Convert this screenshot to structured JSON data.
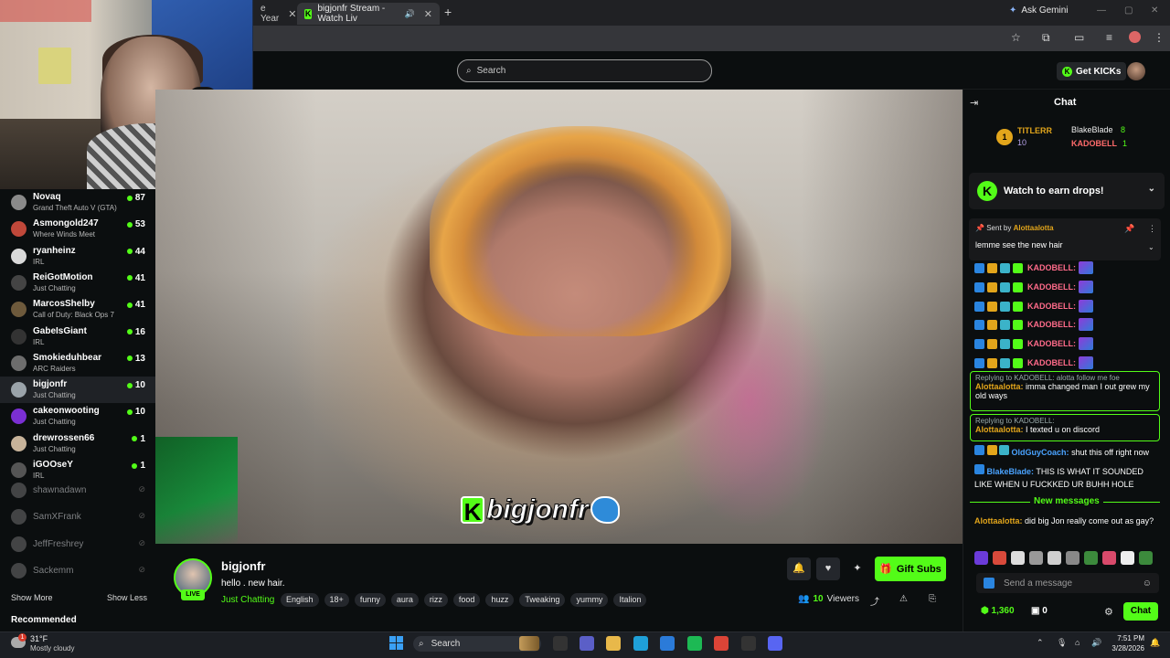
{
  "browser": {
    "tab1_title": "e Year",
    "tab2_title": "bigjonfr Stream - Watch Liv",
    "ask_gemini": "Ask Gemini"
  },
  "header": {
    "search_placeholder": "Search",
    "get_kicks": "Get KICKs"
  },
  "sidebar": {
    "channels": [
      {
        "name": "Novaq",
        "category": "Grand Theft Auto V (GTA)",
        "viewers": "87",
        "color": "#8a8a8a"
      },
      {
        "name": "Asmongold247",
        "category": "Where Winds Meet",
        "viewers": "53",
        "color": "#c0483a"
      },
      {
        "name": "ryanheinz",
        "category": "IRL",
        "viewers": "44",
        "color": "#d9d9d9"
      },
      {
        "name": "ReiGotMotion",
        "category": "Just Chatting",
        "viewers": "41",
        "color": "#444"
      },
      {
        "name": "MarcosShelby",
        "category": "Call of Duty: Black Ops 7",
        "viewers": "41",
        "color": "#6e5a3c"
      },
      {
        "name": "GabeIsGiant",
        "category": "IRL",
        "viewers": "16",
        "color": "#333"
      },
      {
        "name": "Smokieduhbear",
        "category": "ARC Raiders",
        "viewers": "13",
        "color": "#6d6d6d"
      },
      {
        "name": "bigjonfr",
        "category": "Just Chatting",
        "viewers": "10",
        "color": "#9aa3a9"
      },
      {
        "name": "cakeonwooting",
        "category": "Just Chatting",
        "viewers": "10",
        "color": "#7a2fd3"
      },
      {
        "name": "drewrossen66",
        "category": "Just Chatting",
        "viewers": "1",
        "color": "#c7b39a"
      },
      {
        "name": "iGOOseY",
        "category": "IRL",
        "viewers": "1",
        "color": "#555"
      }
    ],
    "offline": [
      {
        "name": "shawnadawn"
      },
      {
        "name": "SamXFrank"
      },
      {
        "name": "JeffFreshrey"
      },
      {
        "name": "Sackemm"
      }
    ],
    "show_more": "Show More",
    "show_less": "Show Less",
    "recommended": "Recommended"
  },
  "video": {
    "logo_text": "bigjonfr"
  },
  "stream": {
    "streamer": "bigjonfr",
    "live_label": "LIVE",
    "title": "hello . new hair.",
    "category": "Just Chatting",
    "tags": [
      "English",
      "18+",
      "funny",
      "aura",
      "rizz",
      "food",
      "huzz",
      "Tweaking",
      "yummy",
      "Italion"
    ],
    "viewers_count": "10",
    "viewers_label": "Viewers",
    "gift_subs": "Gift Subs"
  },
  "chat": {
    "title": "Chat",
    "top_gifter_rank": "1",
    "gifter1_name": "TITLERR",
    "gifter1_count": "10",
    "gifter2_name": "BlakeBlade",
    "gifter2_count": "8",
    "gifter3_name": "KADOBELL",
    "gifter3_count": "1",
    "drops": "Watch to earn drops!",
    "pinned_by_label": "Sent by",
    "pinned_by_user": "Alottaalotta",
    "pinned_message": "lemme see the new hair",
    "spam_user": "KADOBELL:",
    "reply1_ref": "Replying to KADOBELL: alotta follow me foe",
    "reply1_user": "Alottaalotta:",
    "reply1_text": "imma changed man I out grew my old ways",
    "reply2_ref": "Replying to KADOBELL:",
    "reply2_user": "Alottaalotta:",
    "reply2_text": "I texted u on discord",
    "msg3_user": "OldGuyCoach:",
    "msg3_text": "shut this off right now",
    "msg4_user": "BlakeBlade:",
    "msg4_text": "THIS IS WHAT IT SOUNDED LIKE WHEN U FUCKKED UR BUHH HOLE",
    "new_messages": "New messages",
    "msg5_user": "Alottaalotta:",
    "msg5_text": "did big Jon really come out as gay?",
    "send_placeholder": "Send a message",
    "points": "1,360",
    "points2": "0",
    "chat_button": "Chat"
  },
  "taskbar": {
    "temperature": "31°F",
    "weather": "Mostly cloudy",
    "notif_count": "1",
    "search": "Search",
    "time": "7:51 PM",
    "date": "3/28/2026"
  }
}
